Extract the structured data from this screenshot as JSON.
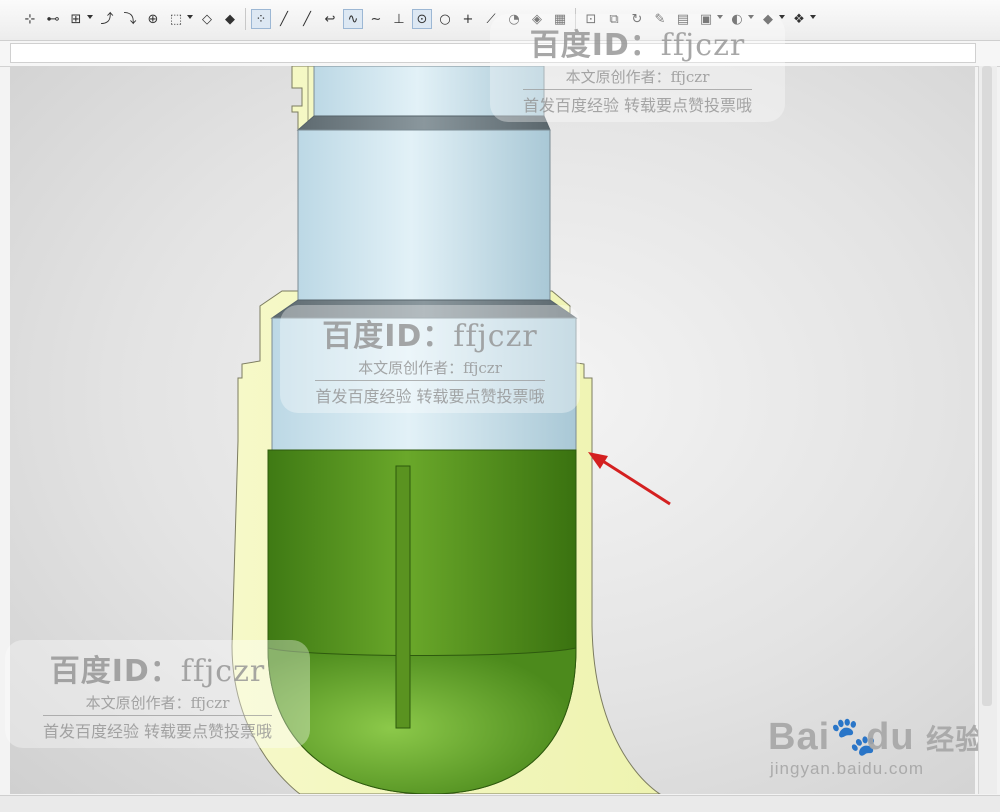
{
  "toolbar": {
    "buttons": [
      {
        "name": "snap-point-icon",
        "glyph": "⊹"
      },
      {
        "name": "select-face-icon",
        "glyph": "⊷"
      },
      {
        "name": "select-component-icon",
        "glyph": "⊞",
        "dropdown": true
      },
      {
        "name": "rotate-icon",
        "glyph": "⤴"
      },
      {
        "name": "filter-icon",
        "glyph": "⤵"
      },
      {
        "name": "select-body-icon",
        "glyph": "⊕"
      },
      {
        "name": "box-select-icon",
        "glyph": "⬚",
        "dropdown": true
      },
      {
        "name": "wireframe-cube-icon",
        "glyph": "◇"
      },
      {
        "name": "solid-cube-icon",
        "glyph": "◆"
      },
      {
        "name": "snap-grid-icon",
        "glyph": "⁘",
        "active": true
      },
      {
        "name": "line-icon",
        "glyph": "╱"
      },
      {
        "name": "line-segment-icon",
        "glyph": "╱"
      },
      {
        "name": "curve-icon",
        "glyph": "↩"
      },
      {
        "name": "spline-icon",
        "glyph": "∿",
        "active": true
      },
      {
        "name": "wave-icon",
        "glyph": "∼"
      },
      {
        "name": "tangent-icon",
        "glyph": "⊥"
      },
      {
        "name": "circle-center-icon",
        "glyph": "⊙",
        "active": true
      },
      {
        "name": "circle-icon",
        "glyph": "○"
      },
      {
        "name": "crosshair-icon",
        "glyph": "+"
      },
      {
        "name": "diagonal-line-icon",
        "glyph": "⟋"
      },
      {
        "name": "arc-icon",
        "glyph": "◔"
      },
      {
        "name": "mesh-icon",
        "glyph": "◈"
      },
      {
        "name": "grid-icon",
        "glyph": "▦"
      },
      {
        "name": "zoom-window-icon",
        "glyph": "⊡"
      },
      {
        "name": "fit-view-icon",
        "glyph": "⧉"
      },
      {
        "name": "refresh-icon",
        "glyph": "↻"
      },
      {
        "name": "pen-icon",
        "glyph": "✎"
      },
      {
        "name": "clipboard-icon",
        "glyph": "▤"
      },
      {
        "name": "layout-icon",
        "glyph": "▣",
        "dropdown": true
      },
      {
        "name": "shading-icon",
        "glyph": "◐",
        "dropdown": true
      },
      {
        "name": "view-cube-icon",
        "glyph": "◆",
        "dropdown": true
      },
      {
        "name": "render-style-icon",
        "glyph": "❖",
        "dropdown": true
      }
    ]
  },
  "watermark": {
    "title_prefix": "百度ID：",
    "title_id": "ffjczr",
    "author_line": "本文原创作者：ffjczr",
    "notice_line": "首发百度经验 转载要点赞投票哦"
  },
  "baidu_logo": {
    "brand": "Bai",
    "brand_du": "du",
    "suffix": "经验",
    "url": "jingyan.baidu.com"
  },
  "colors": {
    "shell": "#f0f4b8",
    "shaft": "#cfe6ef",
    "fill_green": "#5e9a23",
    "arrow": "#d42020"
  }
}
